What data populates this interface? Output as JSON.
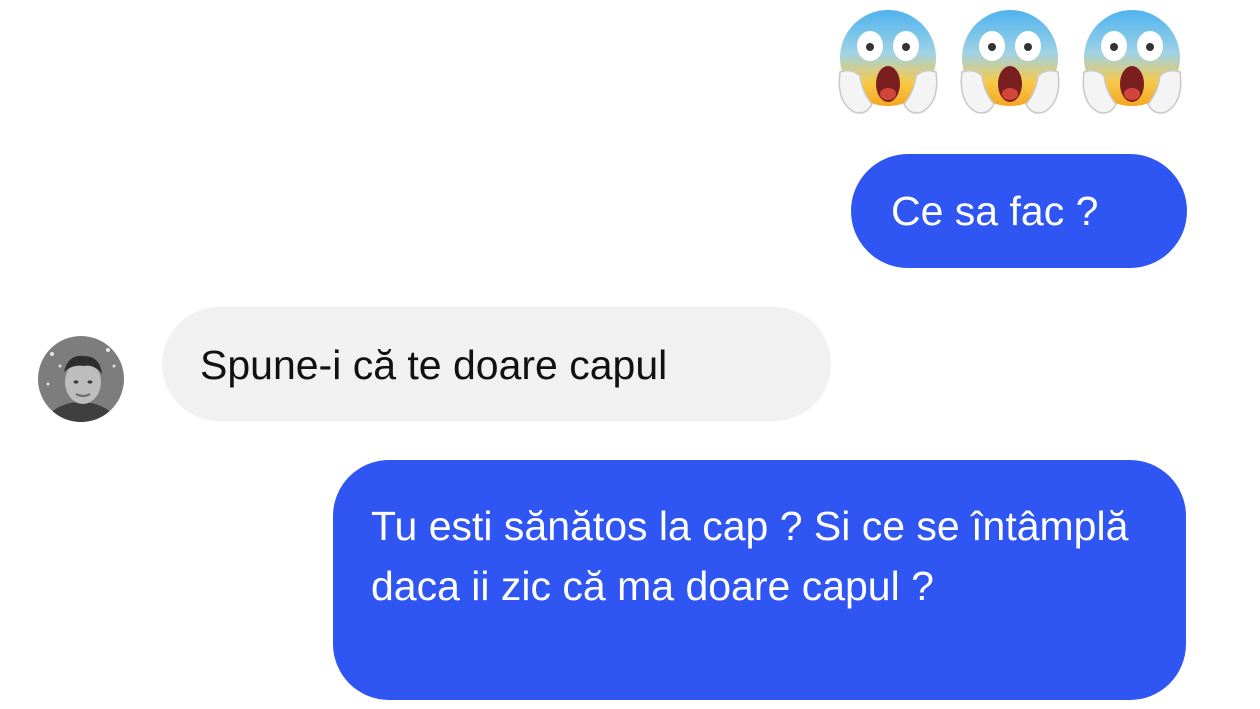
{
  "conversation": {
    "reactions": {
      "emojis": [
        "face-screaming-in-fear-icon",
        "face-screaming-in-fear-icon",
        "face-screaming-in-fear-icon"
      ]
    },
    "messages": [
      {
        "sender": "me",
        "text": "Ce sa fac ?"
      },
      {
        "sender": "contact",
        "text": "Spune-i că te doare capul"
      },
      {
        "sender": "me",
        "text": "Tu esti sănătos la cap ? Si ce se întâmplă daca ii zic că ma doare capul ?"
      }
    ],
    "contact": {
      "avatar_icon": "contact-avatar"
    }
  },
  "colors": {
    "outgoing_bubble": "#2f55f2",
    "incoming_bubble": "#f1f1f1"
  }
}
